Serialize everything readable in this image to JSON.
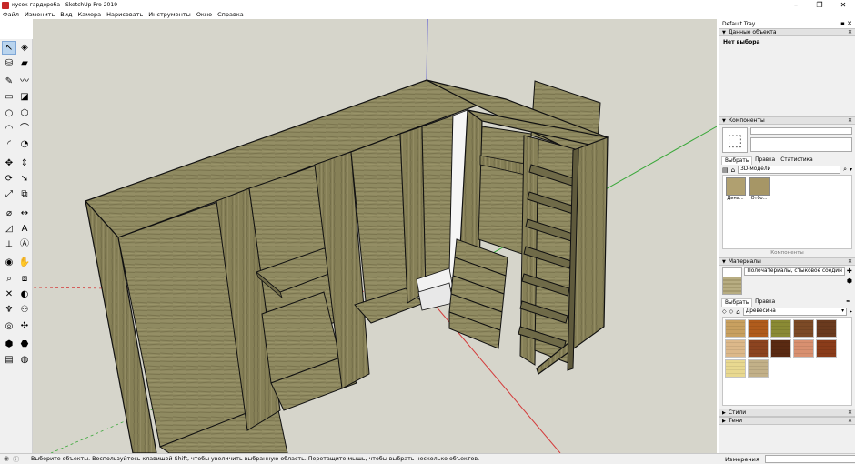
{
  "window": {
    "title": "кусок гардероба - SketchUp Pro 2019",
    "controls": [
      "–",
      "❐",
      "✕"
    ]
  },
  "menu": [
    "Файл",
    "Изменить",
    "Вид",
    "Камера",
    "Нарисовать",
    "Инструменты",
    "Окно",
    "Справка"
  ],
  "toolbar": {
    "tools": [
      {
        "icon": "select-arrow-icon",
        "glyph": "↖",
        "selected": true
      },
      {
        "icon": "make-component-icon",
        "glyph": "◈"
      },
      {
        "icon": "paint-bucket-icon",
        "glyph": "⛁"
      },
      {
        "icon": "eraser-icon",
        "glyph": "▰"
      },
      {
        "icon": "line-pencil-icon",
        "glyph": "✎"
      },
      {
        "icon": "freehand-icon",
        "glyph": "〰"
      },
      {
        "icon": "rectangle-icon",
        "glyph": "▭"
      },
      {
        "icon": "rotated-rectangle-icon",
        "glyph": "◪"
      },
      {
        "icon": "circle-icon",
        "glyph": "○"
      },
      {
        "icon": "polygon-icon",
        "glyph": "⬡"
      },
      {
        "icon": "arc-icon",
        "glyph": "◠"
      },
      {
        "icon": "two-point-arc-icon",
        "glyph": "⌒"
      },
      {
        "icon": "three-point-arc-icon",
        "glyph": "◜"
      },
      {
        "icon": "pie-icon",
        "glyph": "◔"
      },
      {
        "icon": "move-icon",
        "glyph": "✥"
      },
      {
        "icon": "push-pull-icon",
        "glyph": "⇕"
      },
      {
        "icon": "rotate-icon",
        "glyph": "⟳"
      },
      {
        "icon": "follow-me-icon",
        "glyph": "➘"
      },
      {
        "icon": "scale-icon",
        "glyph": "⤢"
      },
      {
        "icon": "offset-icon",
        "glyph": "⧉"
      },
      {
        "icon": "tape-measure-icon",
        "glyph": "⌀"
      },
      {
        "icon": "dimension-icon",
        "glyph": "↔"
      },
      {
        "icon": "protractor-icon",
        "glyph": "◿"
      },
      {
        "icon": "text-icon",
        "glyph": "A"
      },
      {
        "icon": "axes-icon",
        "glyph": "⟂"
      },
      {
        "icon": "3d-text-icon",
        "glyph": "Ⓐ"
      },
      {
        "icon": "orbit-icon",
        "glyph": "◉"
      },
      {
        "icon": "pan-icon",
        "glyph": "✋"
      },
      {
        "icon": "zoom-icon",
        "glyph": "⌕"
      },
      {
        "icon": "zoom-window-icon",
        "glyph": "⧈"
      },
      {
        "icon": "zoom-extents-icon",
        "glyph": "✕"
      },
      {
        "icon": "previous-view-icon",
        "glyph": "◐"
      },
      {
        "icon": "position-camera-icon",
        "glyph": "♆"
      },
      {
        "icon": "walk-icon",
        "glyph": "⚇"
      },
      {
        "icon": "look-around-icon",
        "glyph": "◎"
      },
      {
        "icon": "section-plane-icon",
        "glyph": "✣"
      },
      {
        "icon": "warehouse-icon",
        "glyph": "⬢"
      },
      {
        "icon": "extension-warehouse-icon",
        "glyph": "⬣"
      },
      {
        "icon": "send-to-layout-icon",
        "glyph": "▤"
      },
      {
        "icon": "extension-manager-icon",
        "glyph": "◍"
      }
    ]
  },
  "status": {
    "message": "Выберите объекты. Воспользуйтесь клавишей Shift, чтобы увеличить выбранную область. Перетащите мышь, чтобы выбрать несколько объектов.",
    "measurements_label": "Измерения"
  },
  "tray": {
    "title": "Default Tray",
    "entity_info": {
      "header": "Данные объекта",
      "selection": "Нет выбора"
    },
    "components": {
      "header": "Компоненты",
      "tabs": [
        "Выбрать",
        "Правка",
        "Статистика"
      ],
      "search_value": "3D-модели",
      "items": [
        "Дина...",
        "Отбо..."
      ],
      "footer": "Компоненты"
    },
    "materials": {
      "header": "Материалы",
      "current_name": "Полочатериалы, стыковое соедин",
      "tabs": [
        "Выбрать",
        "Правка"
      ],
      "library": "Древесина",
      "swatch_colors": [
        "#c8a060",
        "#b05c1c",
        "#8a8a34",
        "#7c4a26",
        "#6a3a1e",
        "#dcb88a",
        "#8c4420",
        "#5a2a12",
        "#d89070",
        "#8a3c1a",
        "#e8d890",
        "#c2b088"
      ]
    },
    "collapsed_panels": [
      "Стили",
      "Тени"
    ]
  }
}
